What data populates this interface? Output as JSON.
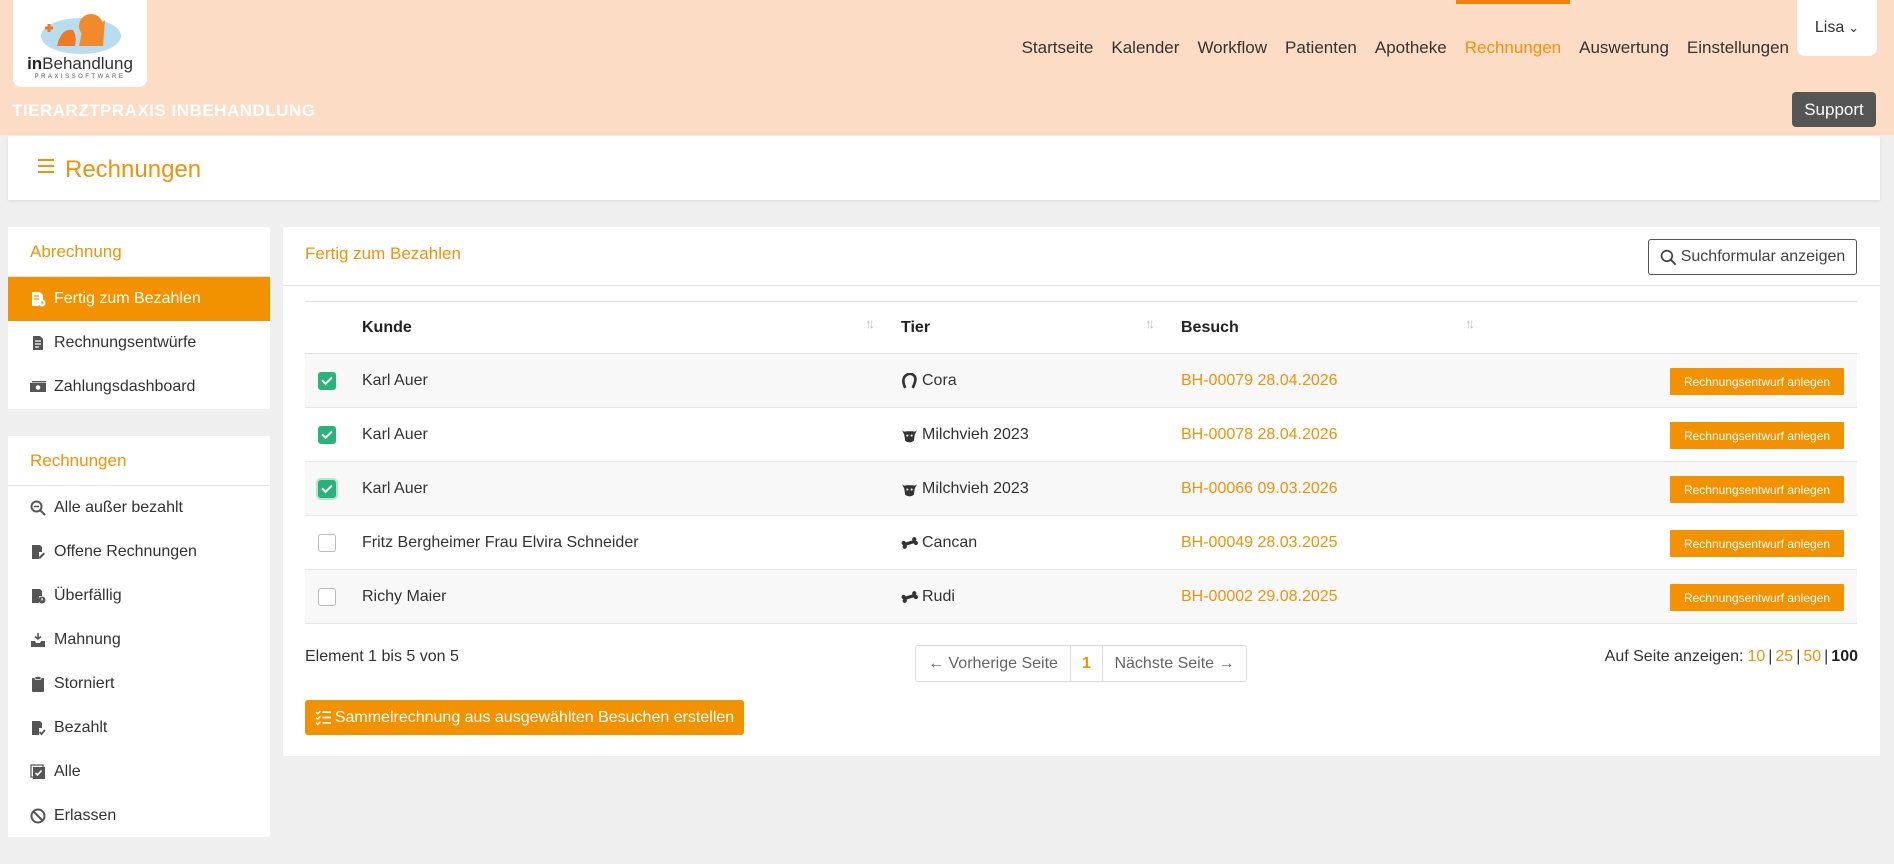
{
  "header": {
    "logo_text_bold": "in",
    "logo_text_rest": "Behandlung",
    "logo_subtext": "PRAXISSOFTWARE",
    "clinic_name": "TIERARZTPRAXIS INBEHANDLUNG",
    "user_name": "Lisa",
    "support_label": "Support",
    "nav": [
      "Startseite",
      "Kalender",
      "Workflow",
      "Patienten",
      "Apotheke",
      "Rechnungen",
      "Auswertung",
      "Einstellungen"
    ],
    "active_nav": "Rechnungen"
  },
  "page": {
    "title": "Rechnungen"
  },
  "sidebar": {
    "group1": {
      "title": "Abrechnung",
      "items": [
        {
          "label": "Fertig zum Bezahlen",
          "icon": "invoice-clock-icon",
          "active": true
        },
        {
          "label": "Rechnungsentwürfe",
          "icon": "document-icon",
          "active": false
        },
        {
          "label": "Zahlungsdashboard",
          "icon": "money-icon",
          "active": false
        }
      ]
    },
    "group2": {
      "title": "Rechnungen",
      "items": [
        {
          "label": "Alle außer bezahlt",
          "icon": "search-minus-icon"
        },
        {
          "label": "Offene Rechnungen",
          "icon": "invoice-pen-icon"
        },
        {
          "label": "Überfällig",
          "icon": "invoice-alert-icon"
        },
        {
          "label": "Mahnung",
          "icon": "inbox-download-icon"
        },
        {
          "label": "Storniert",
          "icon": "clipboard-icon"
        },
        {
          "label": "Bezahlt",
          "icon": "invoice-check-icon"
        },
        {
          "label": "Alle",
          "icon": "checklist-icon"
        },
        {
          "label": "Erlassen",
          "icon": "ban-icon"
        }
      ]
    }
  },
  "main": {
    "title": "Fertig zum Bezahlen",
    "search_button": "Suchformular anzeigen",
    "columns": {
      "customer": "Kunde",
      "animal": "Tier",
      "visit": "Besuch"
    },
    "rows": [
      {
        "checked": true,
        "customer": "Karl Auer",
        "animal": "Cora",
        "animal_icon": "horseshoe-icon",
        "visit": "BH-00079 28.04.2026",
        "action": "Rechnungsentwurf anlegen"
      },
      {
        "checked": true,
        "customer": "Karl Auer",
        "animal": "Milchvieh 2023",
        "animal_icon": "cow-icon",
        "visit": "BH-00078 28.04.2026",
        "action": "Rechnungsentwurf anlegen"
      },
      {
        "checked": true,
        "customer": "Karl Auer",
        "animal": "Milchvieh 2023",
        "animal_icon": "cow-icon",
        "visit": "BH-00066 09.03.2026",
        "action": "Rechnungsentwurf anlegen"
      },
      {
        "checked": false,
        "customer": "Fritz Bergheimer Frau Elvira Schneider",
        "animal": "Cancan",
        "animal_icon": "bone-icon",
        "visit": "BH-00049 28.03.2025",
        "action": "Rechnungsentwurf anlegen"
      },
      {
        "checked": false,
        "customer": "Richy Maier",
        "animal": "Rudi",
        "animal_icon": "bone-icon",
        "visit": "BH-00002 29.08.2025",
        "action": "Rechnungsentwurf anlegen"
      }
    ],
    "info": "Element 1 bis 5 von 5",
    "pager": {
      "prev": "← Vorherige Seite",
      "current": "1",
      "next": "Nächste Seite →"
    },
    "per_page": {
      "label": "Auf Seite anzeigen:",
      "options": [
        "10",
        "25",
        "50",
        "100"
      ],
      "current": "100"
    },
    "bulk_button": "Sammelrechnung aus ausgewählten Besuchen erstellen"
  },
  "colors": {
    "accent": "#f39200",
    "header_bg": "#fcdcc5",
    "check": "#2ab27b"
  }
}
